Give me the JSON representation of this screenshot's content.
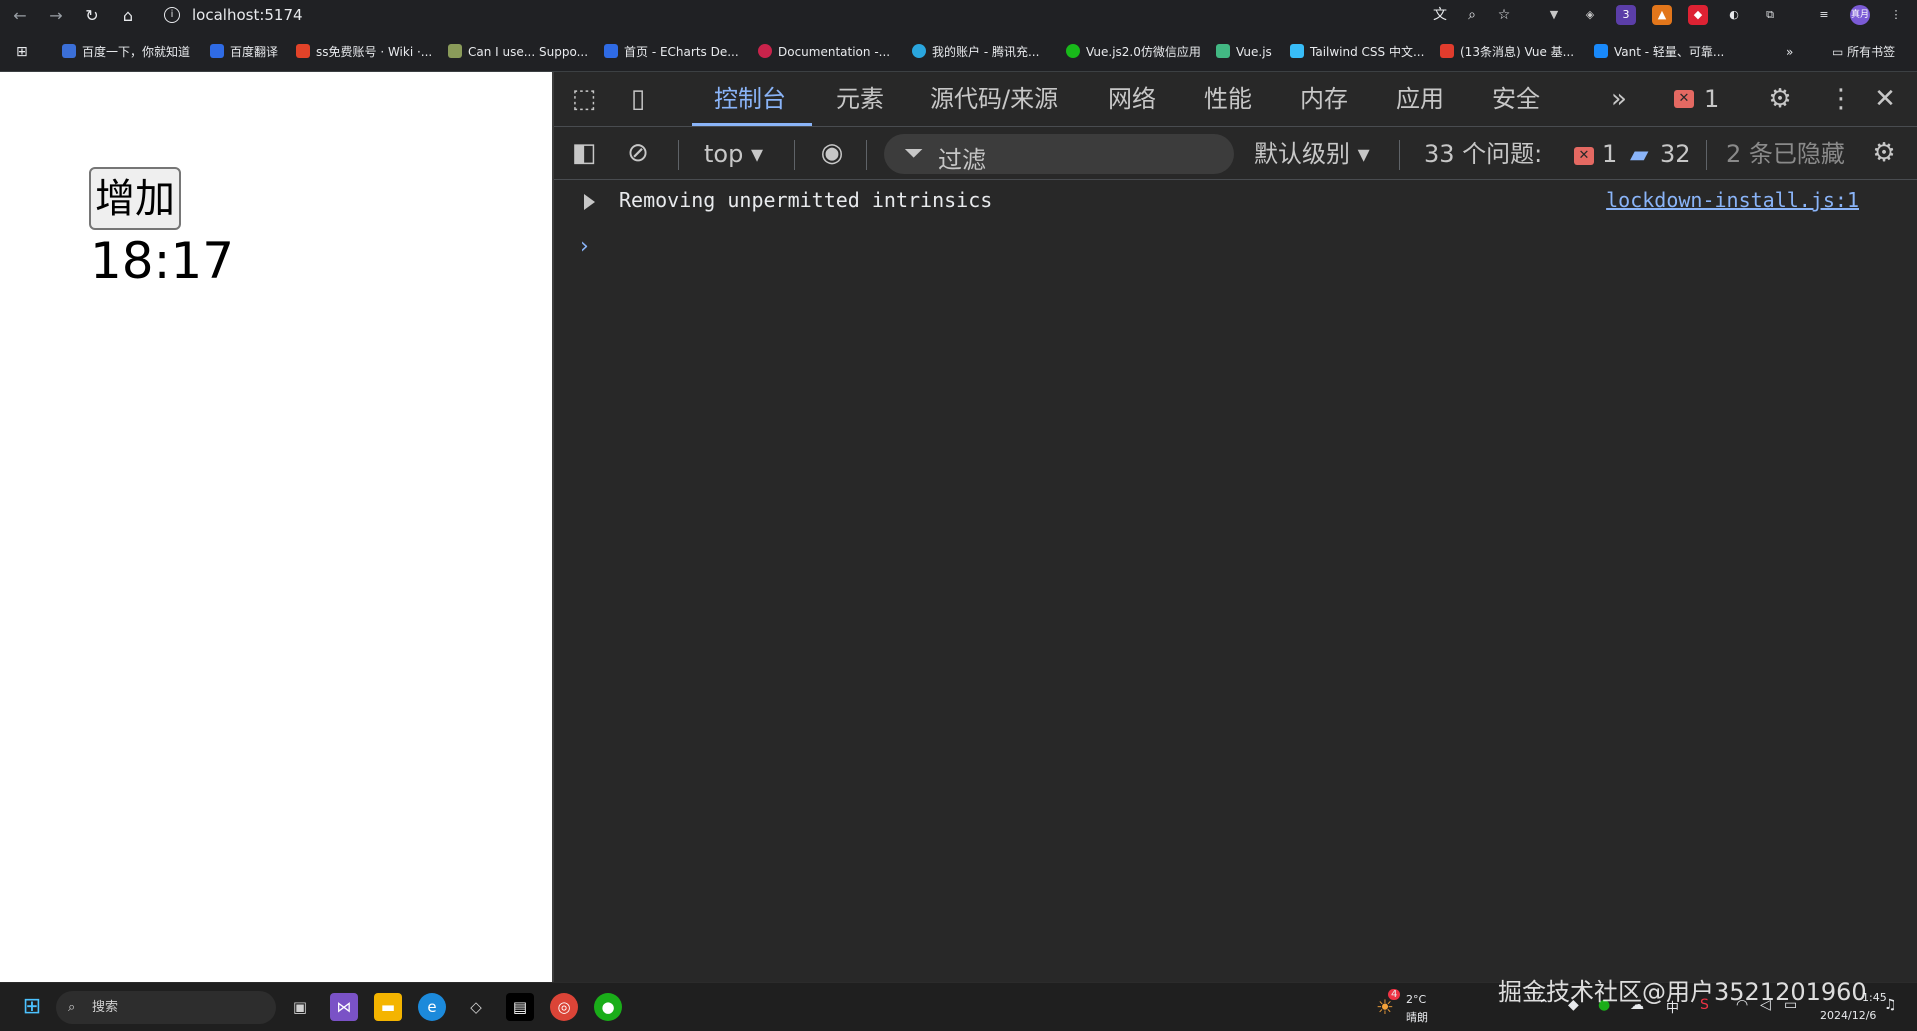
{
  "browser": {
    "url": "localhost:5174",
    "bookmarks": [
      {
        "label": "百度一下，你就知道",
        "color": "#3b6fd8"
      },
      {
        "label": "百度翻译",
        "color": "#2f6be5"
      },
      {
        "label": "ss免费账号 · Wiki ·...",
        "color": "#e24329"
      },
      {
        "label": "Can I use... Suppo...",
        "color": "#8a9b5a"
      },
      {
        "label": "首页 - ECharts De...",
        "color": "#2f6be5"
      },
      {
        "label": "Documentation -...",
        "color": "#c9234b"
      },
      {
        "label": "我的账户 - 腾讯充...",
        "color": "#2aa6de"
      },
      {
        "label": "Vue.js2.0仿微信应用",
        "color": "#18b91a"
      },
      {
        "label": "Vue.js",
        "color": "#42b883"
      },
      {
        "label": "Tailwind CSS 中文...",
        "color": "#38bdf8"
      },
      {
        "label": "(13条消息) Vue 基...",
        "color": "#e03c2d"
      },
      {
        "label": "Vant - 轻量、可靠...",
        "color": "#1989fa"
      }
    ],
    "all_bookmarks_label": "所有书签",
    "profile_label": "真月"
  },
  "page": {
    "increment_button": "增加",
    "clock": "18:17"
  },
  "devtools": {
    "tabs": [
      "控制台",
      "元素",
      "源代码/来源",
      "网络",
      "性能",
      "内存",
      "应用",
      "安全"
    ],
    "error_count": "1",
    "context": "top",
    "filter_placeholder": "过滤",
    "level": "默认级别",
    "issues_label": "33 个问题:",
    "issues_errors": "1",
    "issues_messages": "32",
    "hidden_label": "2 条已隐藏",
    "console": {
      "message": "Removing unpermitted intrinsics",
      "source": "lockdown-install.js:1"
    }
  },
  "taskbar": {
    "search_label": "搜索",
    "weather_temp": "2°C",
    "weather_text": "晴朗",
    "weather_badge": "4",
    "ime": "中",
    "time": "1:45",
    "date": "2024/12/6"
  },
  "watermark": "掘金技术社区@用户3521201960"
}
